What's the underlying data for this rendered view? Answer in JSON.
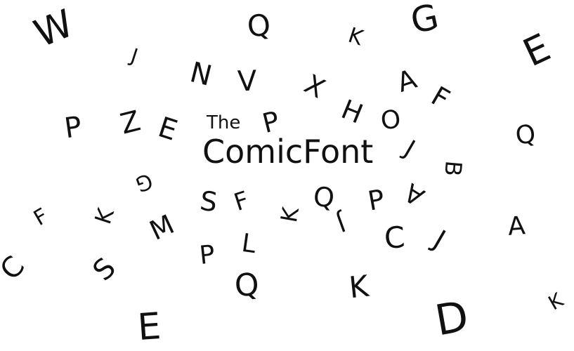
{
  "title": {
    "prefix": "The",
    "main": "ComicFont"
  },
  "letters": [
    "W",
    "Q",
    "G",
    "K",
    "E",
    "J",
    "N",
    "V",
    "X",
    "A",
    "F",
    "P",
    "Z",
    "E",
    "P",
    "H",
    "O",
    "Q",
    "J",
    "B",
    "G",
    "S",
    "F",
    "K",
    "Q",
    "P",
    "A",
    "F",
    "K",
    "M",
    "L",
    "J",
    "C",
    "J",
    "A",
    "C",
    "S",
    "P",
    "Q",
    "K",
    "E",
    "D",
    "K"
  ]
}
